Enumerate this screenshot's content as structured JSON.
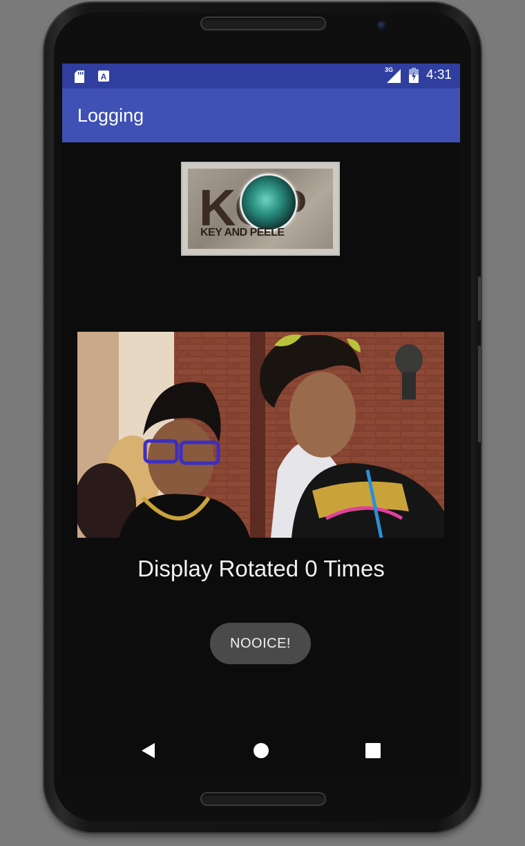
{
  "status_bar": {
    "time": "4:31",
    "network": "3G",
    "icons": [
      "sd-card-icon",
      "keyboard-a-icon",
      "signal-icon",
      "battery-icon"
    ]
  },
  "app_bar": {
    "title": "Logging"
  },
  "logo": {
    "letters": "KOP",
    "subtitle": "KEY AND PEELE"
  },
  "main": {
    "rotation_text": "Display Rotated 0 Times",
    "button_label": "NOOICE!"
  },
  "nav": {
    "icons": [
      "back-icon",
      "home-icon",
      "recents-icon"
    ]
  },
  "colors": {
    "status_bar": "#303f9f",
    "app_bar": "#3f51b5",
    "background": "#0c0c0c",
    "button": "#4a4a4a"
  }
}
